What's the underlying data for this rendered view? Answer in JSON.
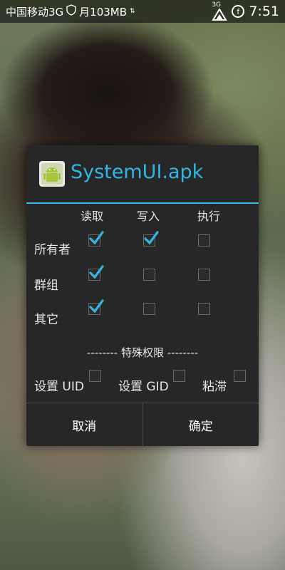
{
  "status_bar": {
    "carrier": "中国移动3G",
    "data_usage": "月103MB",
    "signal_label": "3G",
    "time": "7:51"
  },
  "dialog": {
    "title": "SystemUI.apk",
    "columns": [
      "读取",
      "写入",
      "执行"
    ],
    "rows": [
      {
        "label": "所有者",
        "checked": [
          true,
          true,
          false
        ]
      },
      {
        "label": "群组",
        "checked": [
          true,
          false,
          false
        ]
      },
      {
        "label": "其它",
        "checked": [
          true,
          false,
          false
        ]
      }
    ],
    "special_heading": "-------- 特殊权限 --------",
    "special_options": [
      {
        "label": "设置 UID",
        "checked": false
      },
      {
        "label": "设置 GID",
        "checked": false
      },
      {
        "label": "粘滞",
        "checked": false
      }
    ],
    "cancel_label": "取消",
    "ok_label": "确定"
  },
  "colors": {
    "accent": "#33b5e5",
    "dialog_bg": "#272727"
  }
}
